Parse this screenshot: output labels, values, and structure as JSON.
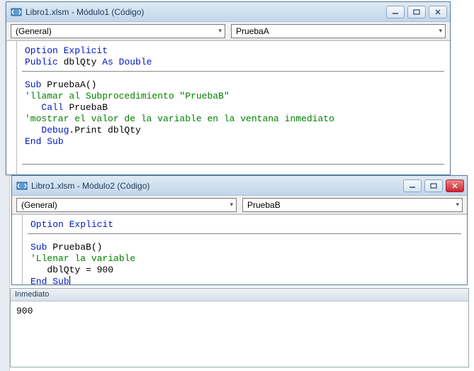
{
  "win1": {
    "title": "Libro1.xlsm - Módulo1 (Código)",
    "combo_left": "(General)",
    "combo_right": "PruebaA",
    "code": {
      "l1a": "Option",
      "l1b": "Explicit",
      "l2a": "Public",
      "l2b": "dblQty",
      "l2c": "As",
      "l2d": "Double",
      "l3a": "Sub",
      "l3b": "PruebaA()",
      "l4": "'llamar al Subprocedimiento \"PruebaB\"",
      "l5a": "Call",
      "l5b": "PruebaB",
      "l6": "'mostrar el valor de la variable en la ventana inmediato",
      "l7a": "Debug",
      "l7b": ".Print dblQty",
      "l8a": "End",
      "l8b": "Sub"
    }
  },
  "win2": {
    "title": "Libro1.xlsm - Módulo2 (Código)",
    "combo_left": "(General)",
    "combo_right": "PruebaB",
    "code": {
      "l1a": "Option",
      "l1b": "Explicit",
      "l2a": "Sub",
      "l2b": "PruebaB()",
      "l3": "'Llenar la variable",
      "l4": "   dblQty = 900",
      "l5a": "End",
      "l5b": "Sub"
    }
  },
  "immediate": {
    "title": "Inmediato",
    "output": "900"
  }
}
